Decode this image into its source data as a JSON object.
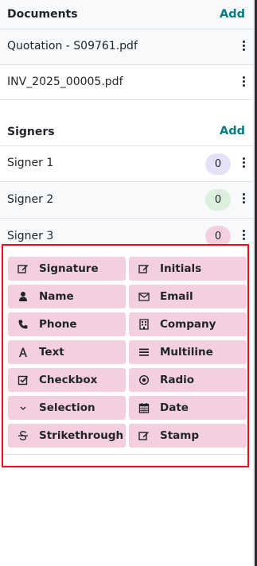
{
  "documents": {
    "title": "Documents",
    "add_label": "Add",
    "items": [
      {
        "name": "Quotation - S09761.pdf"
      },
      {
        "name": "INV_2025_00005.pdf"
      }
    ]
  },
  "signers": {
    "title": "Signers",
    "add_label": "Add",
    "items": [
      {
        "name": "Signer 1",
        "count": "0",
        "color": "#e5e2f7"
      },
      {
        "name": "Signer 2",
        "count": "0",
        "color": "#dcf1dd"
      },
      {
        "name": "Signer 3",
        "count": "0",
        "color": "#f4cfe0"
      }
    ]
  },
  "fields": [
    {
      "label": "Signature",
      "icon": "signature-icon"
    },
    {
      "label": "Initials",
      "icon": "initials-icon"
    },
    {
      "label": "Name",
      "icon": "user-icon"
    },
    {
      "label": "Email",
      "icon": "envelope-icon"
    },
    {
      "label": "Phone",
      "icon": "phone-icon"
    },
    {
      "label": "Company",
      "icon": "building-icon"
    },
    {
      "label": "Text",
      "icon": "text-icon"
    },
    {
      "label": "Multiline",
      "icon": "multiline-icon"
    },
    {
      "label": "Checkbox",
      "icon": "checkbox-icon"
    },
    {
      "label": "Radio",
      "icon": "radio-icon"
    },
    {
      "label": "Selection",
      "icon": "chevron-down-icon"
    },
    {
      "label": "Date",
      "icon": "calendar-icon"
    },
    {
      "label": "Strikethrough",
      "icon": "strikethrough-icon"
    },
    {
      "label": "Stamp",
      "icon": "stamp-icon"
    }
  ],
  "colors": {
    "accent": "#017e84",
    "field_bg": "#f4cfe0",
    "highlight_border": "#e8101a"
  }
}
